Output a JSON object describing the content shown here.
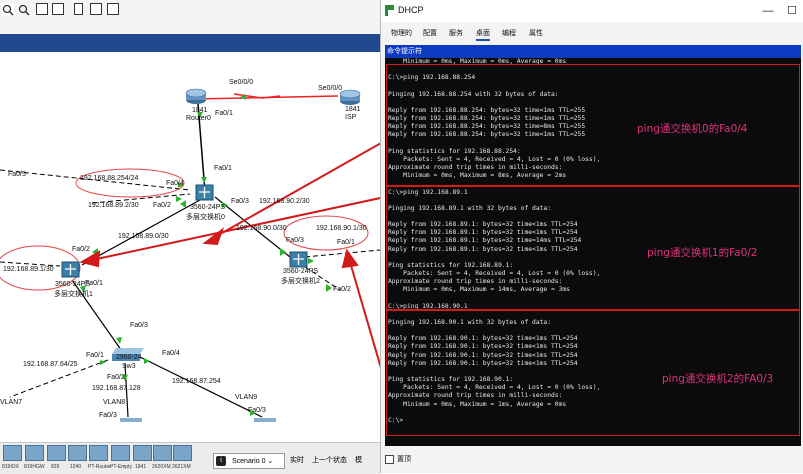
{
  "toolbar": {
    "icons": [
      "search-icon",
      "zoom-in-icon",
      "zoom-out-icon",
      "rect-select-icon",
      "note-icon",
      "palette-icon",
      "custom-icon"
    ]
  },
  "topology": {
    "routers": [
      {
        "name": "1841",
        "role": "Router0"
      },
      {
        "name": "1841",
        "role": "ISP"
      }
    ],
    "switches": [
      {
        "model": "3560-24PS",
        "label": "多层交换机0"
      },
      {
        "model": "3560-24PS",
        "label": "多层交换机1"
      },
      {
        "model": "3560-24PS",
        "label": "多层交换机2"
      },
      {
        "model": "2960-24",
        "label": "Sw3"
      }
    ],
    "labels": {
      "se_left": "Se0/0/0",
      "se_right": "Se0/0/0",
      "r0_fa01": "Fa0/1",
      "ms0_fa01": "Fa0/1",
      "ms0_fa04": "Fa0/4",
      "ms0_fa02": "Fa0/2",
      "ms0_fa03": "Fa0/3",
      "ip_254": "192.168.88.254/24",
      "ip_892": "192.168.89.2/30",
      "ip_902": "192.168.90.2/30",
      "ip_890": "192.168.89.0/30",
      "ip_900": "192.168.90.0/30",
      "ip_901": "192.168.90.1/30",
      "ip_891": "192.168.89.1/30",
      "fa05": "Fa0/5",
      "ms1_fa02": "Fa0/2",
      "ms1_fa01": "Fa0/1",
      "ms2_fa03": "Fa0/3",
      "ms2_fa01": "Fa0/1",
      "ms2_fa02": "Fa0/2",
      "sw3_fa03": "Fa0/3",
      "sw3_fa01": "Fa0/1",
      "sw3_fa04": "Fa0/4",
      "sw3_fa02": "Fa0/2",
      "ip_8764": "192.168.87.64/25",
      "ip_87128": "192.168.87.128",
      "ip_87254": "192.168.87.254",
      "vlan7": "VLAN7",
      "vlan8": "VLAN8",
      "vlan9": "VLAN9",
      "fa03_a": "Fa0/3",
      "fa03_b": "Fa0/3"
    }
  },
  "bottom": {
    "devices": [
      "819IOX",
      "819HGW",
      "829",
      "1240",
      "PT-Router",
      "PT-Empty",
      "1841",
      "2620XM",
      "2621XM"
    ],
    "scenario": "Scenario 0",
    "realtime": "实时",
    "prev": "上一个状态",
    "sim": "模"
  },
  "dhcp": {
    "title": "DHCP",
    "tabs": [
      "物理的",
      "配置",
      "服务",
      "桌面",
      "编程",
      "属性"
    ],
    "console_header": "命令提示符",
    "top_label": "置顶",
    "terminal_lines": [
      "    Minimum = 0ms, Maximum = 0ms, Average = 0ms",
      "",
      "C:\\>ping 192.168.88.254",
      "",
      "Pinging 192.168.88.254 with 32 bytes of data:",
      "",
      "Reply from 192.168.88.254: bytes=32 time<1ms TTL=255",
      "Reply from 192.168.88.254: bytes=32 time<1ms TTL=255",
      "Reply from 192.168.88.254: bytes=32 time=8ms TTL=255",
      "Reply from 192.168.88.254: bytes=32 time<1ms TTL=255",
      "",
      "Ping statistics for 192.168.88.254:",
      "    Packets: Sent = 4, Received = 4, Lost = 0 (0% loss),",
      "Approximate round trip times in milli-seconds:",
      "    Minimum = 0ms, Maximum = 8ms, Average = 2ms",
      "",
      "C:\\>ping 192.168.89.1",
      "",
      "Pinging 192.168.89.1 with 32 bytes of data:",
      "",
      "Reply from 192.168.89.1: bytes=32 time<1ms TTL=254",
      "Reply from 192.168.89.1: bytes=32 time<1ms TTL=254",
      "Reply from 192.168.89.1: bytes=32 time=14ms TTL=254",
      "Reply from 192.168.89.1: bytes=32 time<1ms TTL=254",
      "",
      "Ping statistics for 192.168.89.1:",
      "    Packets: Sent = 4, Received = 4, Lost = 0 (0% loss),",
      "Approximate round trip times in milli-seconds:",
      "    Minimum = 0ms, Maximum = 14ms, Average = 3ms",
      "",
      "C:\\>ping 192.168.90.1",
      "",
      "Pinging 192.168.90.1 with 32 bytes of data:",
      "",
      "Reply from 192.168.90.1: bytes=32 time<1ms TTL=254",
      "Reply from 192.168.90.1: bytes=32 time<1ms TTL=254",
      "Reply from 192.168.90.1: bytes=32 time<1ms TTL=254",
      "Reply from 192.168.90.1: bytes=32 time<1ms TTL=254",
      "",
      "Ping statistics for 192.168.90.1:",
      "    Packets: Sent = 4, Received = 4, Lost = 0 (0% loss),",
      "Approximate round trip times in milli-seconds:",
      "    Minimum = 0ms, Maximum = 1ms, Average = 0ms",
      "",
      "C:\\>"
    ],
    "annotations": [
      "ping通交换机0的Fa0/4",
      "ping通交换机1的Fa0/2",
      "ping通交换机2的FA0/3"
    ]
  },
  "colors": {
    "annotation": "#e0327d",
    "arrow": "#d21a1a",
    "titlebar": "#214a8e",
    "console_header": "#0e3ac2"
  }
}
